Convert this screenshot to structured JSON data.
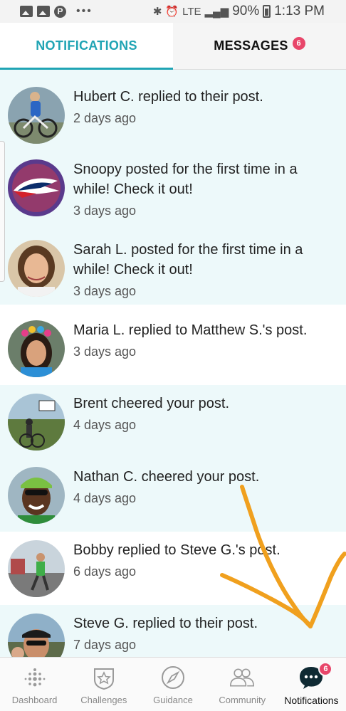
{
  "status_bar": {
    "battery": "90%",
    "time": "1:13 PM",
    "network": "LTE",
    "bluetooth_icon": "bluetooth-icon",
    "signal_icon": "signal-icon"
  },
  "tabs": [
    {
      "label": "NOTIFICATIONS",
      "active": true
    },
    {
      "label": "MESSAGES",
      "badge": "6",
      "active": false
    }
  ],
  "notifications": [
    {
      "text": "Hubert C. replied to their post.",
      "time": "2 days ago",
      "unread": true
    },
    {
      "text": "Snoopy posted for the first time in a while! Check it out!",
      "time": "3 days ago",
      "unread": true
    },
    {
      "text": "Sarah L. posted for the first time in a while! Check it out!",
      "time": "3 days ago",
      "unread": true
    },
    {
      "text": "Maria L. replied to Matthew S.'s post.",
      "time": "3 days ago",
      "unread": false
    },
    {
      "text": "Brent cheered your post.",
      "time": "4 days ago",
      "unread": true
    },
    {
      "text": "Nathan C. cheered your post.",
      "time": "4 days ago",
      "unread": true
    },
    {
      "text": "Bobby replied to Steve G.'s post.",
      "time": "6 days ago",
      "unread": false
    },
    {
      "text": "Steve G. replied to their post.",
      "time": "7 days ago",
      "unread": true
    }
  ],
  "bottom_nav": [
    {
      "label": "Dashboard",
      "icon": "dashboard-dots-icon",
      "active": false
    },
    {
      "label": "Challenges",
      "icon": "star-shield-icon",
      "active": false
    },
    {
      "label": "Guidance",
      "icon": "compass-icon",
      "active": false
    },
    {
      "label": "Community",
      "icon": "community-people-icon",
      "active": false
    },
    {
      "label": "Notifications",
      "icon": "chat-bubble-icon",
      "badge": "6",
      "active": true
    }
  ],
  "colors": {
    "accent": "#20a4b4",
    "badge": "#e8466a",
    "unread_bg": "#edf9fa",
    "annotation": "#f0a01e"
  }
}
